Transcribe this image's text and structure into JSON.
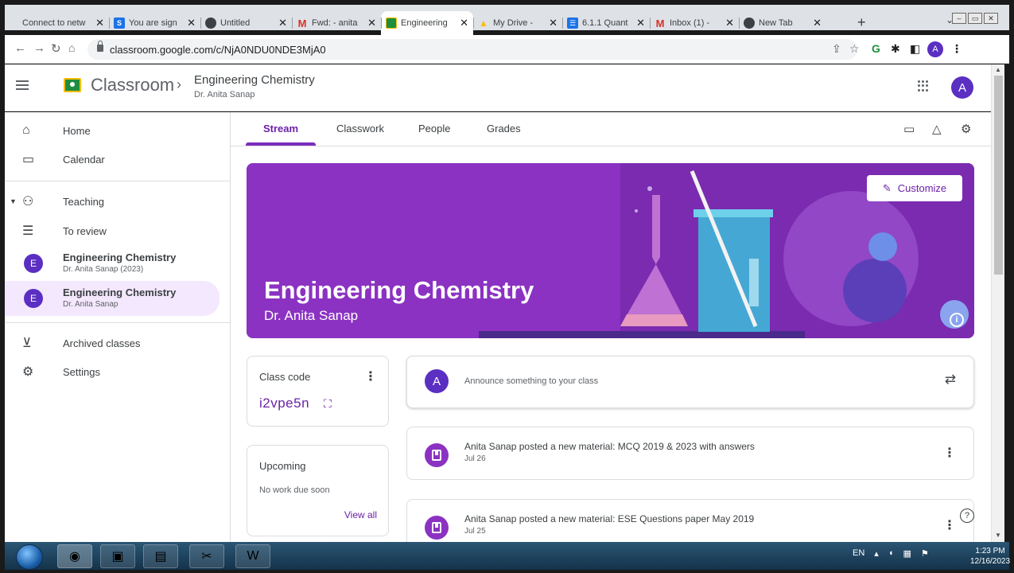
{
  "browser": {
    "tabs": [
      {
        "title": "Connect to netw",
        "fav_color": "#5f6368",
        "fav_glyph": ""
      },
      {
        "title": "You are sign",
        "fav_color": "#1a73e8",
        "fav_glyph": "S"
      },
      {
        "title": "Untitled",
        "fav_color": "#3c4043",
        "fav_glyph": ""
      },
      {
        "title": "Fwd: - anita",
        "fav_color": "#ffffff",
        "fav_glyph": "M"
      },
      {
        "title": "Engineering",
        "fav_color": "#1e8e3e",
        "fav_glyph": ""
      },
      {
        "title": "My Drive -",
        "fav_color": "#ffffff",
        "fav_glyph": "▲"
      },
      {
        "title": "6.1.1 Quant",
        "fav_color": "#1a73e8",
        "fav_glyph": "☰"
      },
      {
        "title": "Inbox (1) -",
        "fav_color": "#ffffff",
        "fav_glyph": "M"
      },
      {
        "title": "New Tab",
        "fav_color": "#3c4043",
        "fav_glyph": ""
      }
    ],
    "url": "classroom.google.com/c/NjA0NDU0NDE3MjA0",
    "profile_initial": "A"
  },
  "app": {
    "brand": "Classroom",
    "class_name": "Engineering Chemistry",
    "teacher": "Dr. Anita Sanap",
    "user_initial": "A"
  },
  "sidebar": {
    "home": "Home",
    "calendar": "Calendar",
    "teaching": "Teaching",
    "to_review": "To review",
    "classes": [
      {
        "initial": "E",
        "name": "Engineering Chemistry",
        "sub": "Dr. Anita Sanap (2023)"
      },
      {
        "initial": "E",
        "name": "Engineering Chemistry",
        "sub": "Dr. Anita Sanap"
      }
    ],
    "archived": "Archived classes",
    "settings": "Settings"
  },
  "main": {
    "tabs": [
      "Stream",
      "Classwork",
      "People",
      "Grades"
    ],
    "banner": {
      "title": "Engineering Chemistry",
      "subtitle": "Dr. Anita Sanap",
      "customize": "Customize"
    },
    "class_code_label": "Class code",
    "class_code": "i2vpe5n",
    "upcoming_label": "Upcoming",
    "no_work": "No work due soon",
    "view_all": "View all",
    "announce_placeholder": "Announce something to your class",
    "posts": [
      {
        "title": "Anita Sanap posted a new material: MCQ 2019 & 2023 with answers",
        "date": "Jul 26"
      },
      {
        "title": "Anita Sanap posted a new material: ESE Questions paper May 2019",
        "date": "Jul 25"
      }
    ]
  },
  "taskbar": {
    "lang": "EN",
    "time": "1:23 PM",
    "date": "12/16/2023"
  },
  "colors": {
    "accent": "#6b21a8",
    "banner": "#8b32c2",
    "avatar": "#5a2fc2"
  }
}
